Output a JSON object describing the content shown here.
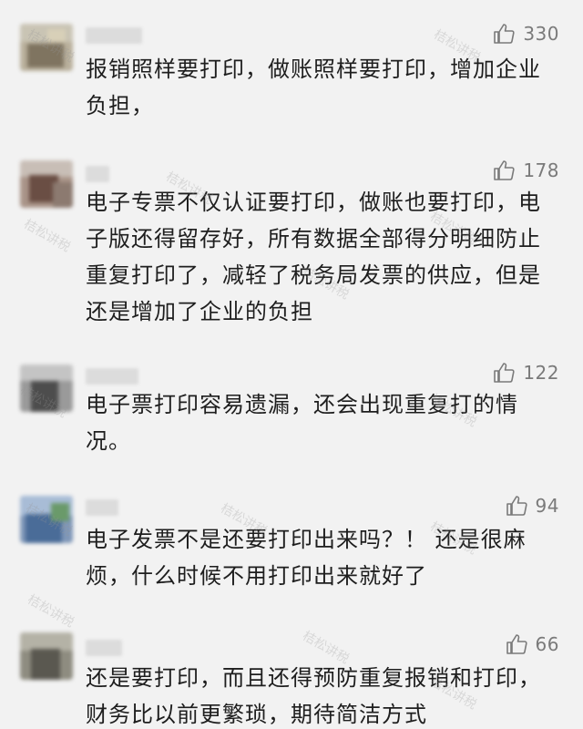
{
  "watermark": "桔松讲税",
  "comments": [
    {
      "likes": "330",
      "text": "报销照样要打印，做账照样要打印，增加企业负担，"
    },
    {
      "likes": "178",
      "text": "电子专票不仅认证要打印，做账也要打印，电子版还得留存好，所有数据全部得分明细防止重复打印了，减轻了税务局发票的供应，但是还是增加了企业的负担"
    },
    {
      "likes": "122",
      "text": "电子票打印容易遗漏，还会出现重复打的情况。"
    },
    {
      "likes": "94",
      "text": "电子发票不是还要打印出来吗？！ 还是很麻烦，什么时候不用打印出来就好了"
    },
    {
      "likes": "66",
      "text": "还是要打印，而且还得预防重复报销和打印，财务比以前更繁琐，期待简洁方式"
    }
  ],
  "icons": {
    "like": "thumbs-up-icon"
  },
  "colors": {
    "background": "#f2f2f2",
    "text": "#1e1e1e",
    "like_count": "#7a7a7a"
  }
}
